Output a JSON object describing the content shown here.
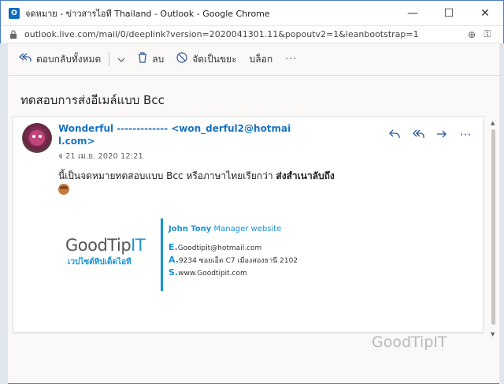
{
  "window": {
    "title": "จดหมาย - ข่าวสารไอที Thailand - Outlook - Google Chrome",
    "minimize": "—",
    "maximize": "☐",
    "close": "✕"
  },
  "address": {
    "url": "outlook.live.com/mail/0/deeplink?version=2020041301.11&popoutv2=1&leanbootstrap=1"
  },
  "toolbar": {
    "reply_all_label": "ตอบกลับทั้งหมด",
    "delete_label": "ลบ",
    "junk_label": "จัดเป็นขยะ",
    "block_label": "บล็อก",
    "more_label": "···"
  },
  "message": {
    "subject": "ทดสอบการส่งอีเมล์แบบ Bcc",
    "sender_line1": "Wonderful ------------- <won_derful2@hotmai",
    "sender_line2": "l.com>",
    "date": "จ 21 เม.ย. 2020 12:21",
    "body_normal": "นี้เป็นจดหมายทดสอบแบบ Bcc หรือภาษาไทยเรียกว่า ",
    "body_bold": "ส่งสำเนาลับถึง"
  },
  "signature": {
    "logo_good": "GoodTip",
    "logo_it": "IT",
    "tagline": "เวปไซต์ทิปเด็ดไอที",
    "name": "John Tony",
    "role": "Manager website",
    "email_label": "E.",
    "email": "Goodtipit@hotmail.com",
    "address_label": "A.",
    "address": "9234 ซอยเอ็ด C7 เมืองสองธานี 2102",
    "site_label": "S.",
    "site": "www.Goodtipit.com"
  },
  "watermark": "GoodTipIT",
  "colors": {
    "accent": "#1a73c2",
    "brand": "#1a93d1",
    "icon": "#2b5797"
  }
}
